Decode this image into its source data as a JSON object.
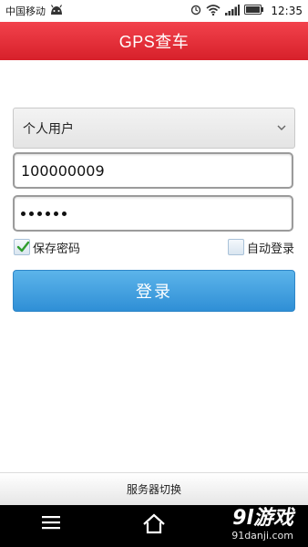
{
  "status_bar": {
    "carrier": "中国移动",
    "time": "12:35"
  },
  "header": {
    "title": "GPS查车"
  },
  "form": {
    "user_type": {
      "selected": "个人用户"
    },
    "account": {
      "value": "100000009"
    },
    "password": {
      "masked_length": 6
    },
    "remember_password": {
      "label": "保存密码",
      "checked": true
    },
    "auto_login": {
      "label": "自动登录",
      "checked": false
    },
    "login_label": "登录"
  },
  "footer": {
    "server_switch_label": "服务器切换"
  },
  "watermark": {
    "logo": "9l游戏",
    "url": "91danji.com"
  },
  "colors": {
    "title_bar": "#e2232c",
    "login_button": "#3c9de0",
    "nav_bar": "#000000"
  },
  "icons": {
    "status_left": [
      "android-icon"
    ],
    "status_right": [
      "sync-icon",
      "wifi-icon",
      "signal-icon",
      "battery-icon"
    ],
    "nav": [
      "menu-icon",
      "home-icon"
    ]
  }
}
